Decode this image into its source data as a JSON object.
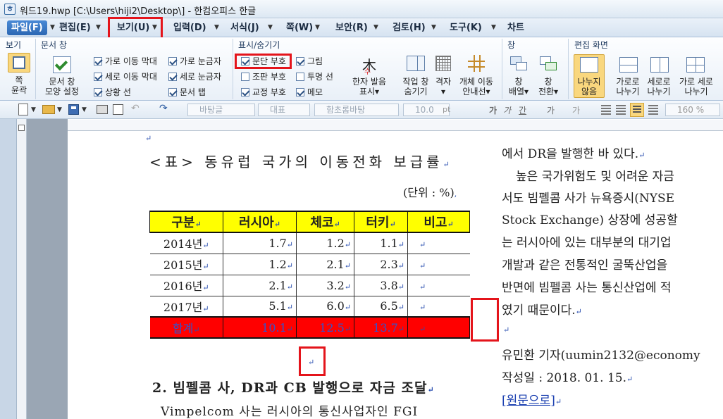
{
  "window": {
    "title": "워드19.hwp [C:\\Users\\hiji2\\Desktop\\] - 한컴오피스 한글"
  },
  "menu": {
    "tabs": [
      "파일(F)",
      "편집(E)",
      "보기(U)",
      "입력(D)",
      "서식(J)",
      "쪽(W)",
      "보안(R)",
      "검토(H)",
      "도구(K)",
      "차트"
    ]
  },
  "ribbon": {
    "groups": {
      "view": "보기",
      "doc_window": "문서 창",
      "show_hide": "표시/숨기기",
      "window": "창",
      "edit_screen": "편집 화면"
    },
    "buttons": {
      "page_outline": [
        "쪽",
        "윤곽"
      ],
      "doc_window_shape": [
        "문서 창",
        "모양 설정"
      ],
      "hanja": [
        "한자 발음",
        "표시▾"
      ],
      "task_window": [
        "작업 창",
        "숨기기"
      ],
      "grid": [
        "격자",
        "▾"
      ],
      "object_move": [
        "개체 이동",
        "안내선▾"
      ],
      "window_arrange": [
        "창",
        "배열▾"
      ],
      "window_switch": [
        "창",
        "전환▾"
      ],
      "no_split": [
        "나누지",
        "않음"
      ],
      "h_split": [
        "가로로",
        "나누기"
      ],
      "v_split": [
        "세로로",
        "나누기"
      ],
      "hv_split": [
        "가로 세로",
        "나누기"
      ]
    },
    "checkboxes": {
      "h_scroll": {
        "label": "가로 이동 막대",
        "checked": true
      },
      "v_scroll": {
        "label": "세로 이동 막대",
        "checked": true
      },
      "status_bar": {
        "label": "상황 선",
        "checked": true
      },
      "h_ruler": {
        "label": "가로 눈금자",
        "checked": true
      },
      "v_ruler": {
        "label": "세로 눈금자",
        "checked": true
      },
      "doc_tabs": {
        "label": "문서 탭",
        "checked": true
      },
      "para_mark": {
        "label": "문단 부호",
        "checked": true
      },
      "layout_mark": {
        "label": "조판 부호",
        "checked": false
      },
      "proof_mark": {
        "label": "교정 부호",
        "checked": true
      },
      "picture": {
        "label": "그림",
        "checked": true
      },
      "transparent_line": {
        "label": "투명 선",
        "checked": false
      },
      "memo": {
        "label": "메모",
        "checked": true
      }
    }
  },
  "format_toolbar": {
    "style": "바탕글",
    "lang": "대표",
    "font": "함초롬바탕",
    "size": "10.0",
    "unit": "pt",
    "zoom": "160 %",
    "bold": "가",
    "italic": "가",
    "underline": "간",
    "char_color": "가",
    "highlight": "가"
  },
  "document": {
    "table_title": "<표> 동유럽 국가의 이동전화 보급률",
    "unit_note": "(단위 : %)",
    "table": {
      "headers": [
        "구분",
        "러시아",
        "체코",
        "터키",
        "비고"
      ],
      "rows": [
        [
          "2014년",
          "1.7",
          "1.2",
          "1.1",
          ""
        ],
        [
          "2015년",
          "1.2",
          "2.1",
          "2.3",
          ""
        ],
        [
          "2016년",
          "2.1",
          "3.2",
          "3.8",
          ""
        ],
        [
          "2017년",
          "5.1",
          "6.0",
          "6.5",
          ""
        ]
      ],
      "total": [
        "합계",
        "10.1",
        "12.5",
        "13.7",
        ""
      ]
    },
    "heading": "2. 빔펠콤 사, DR과 CB 발행으로 자금 조달",
    "para_line": "Vimpelcom 사는 러시아의 통신사업자인 FGI",
    "right_col": [
      "에서 DR을 발행한 바 있다.",
      "높은 국가위험도 및 어려운 자금",
      "서도 빔펠콤 사가 뉴욕증시(NYSE",
      "Stock Exchange) 상장에 성공할",
      "는 러시아에 있는 대부분의 대기업",
      "개발과 같은 전통적인 굴뚝산업을",
      "반면에 빔펠콤 사는 통신산업에 적",
      "였기 때문이다.",
      "",
      "유민환 기자(uumin2132@economy",
      "작성일 : 2018. 01. 15.",
      "[원문으로]"
    ],
    "para_mark": "↵"
  }
}
